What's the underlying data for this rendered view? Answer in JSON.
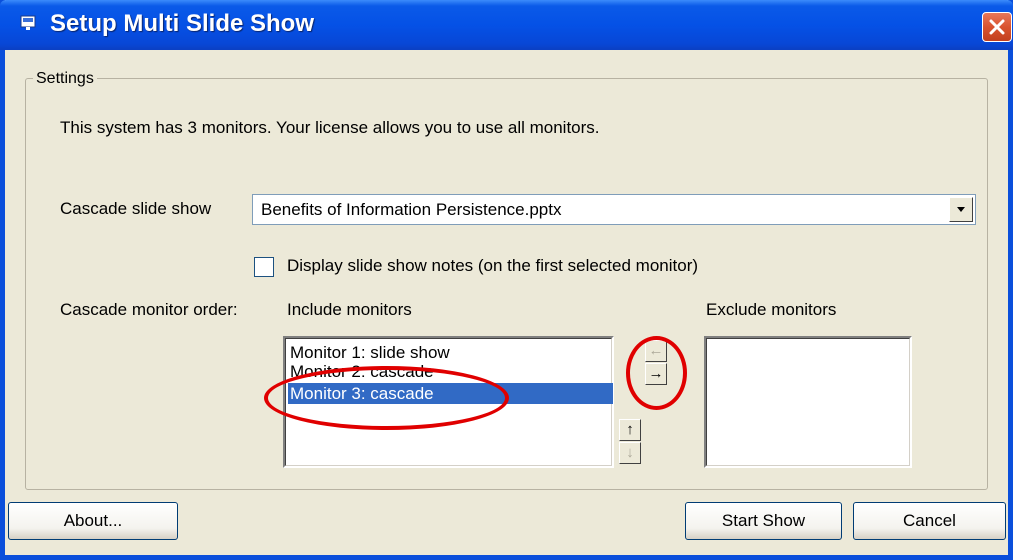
{
  "window": {
    "title": "Setup Multi Slide Show"
  },
  "settings": {
    "group_label": "Settings",
    "info_text": "This system has 3 monitors. Your license allows you to use all monitors.",
    "cascade_label": "Cascade slide show",
    "cascade_value": "Benefits of Information Persistence.pptx",
    "notes_checkbox_label": "Display slide show notes (on the first selected monitor)",
    "notes_checked": false,
    "order_label": "Cascade monitor order:",
    "include_label": "Include monitors",
    "exclude_label": "Exclude monitors",
    "include_items": [
      "Monitor 1: slide show",
      "Monitor 2: cascade",
      "Monitor 3: cascade"
    ],
    "selected_index": 2,
    "exclude_items": []
  },
  "buttons": {
    "about": "About...",
    "start": "Start Show",
    "cancel": "Cancel",
    "move_left": "←",
    "move_right": "→",
    "move_up": "↑",
    "move_down": "↓"
  },
  "colors": {
    "titlebar": "#0551e6",
    "selection": "#316ac5",
    "annotation": "#e00000"
  }
}
